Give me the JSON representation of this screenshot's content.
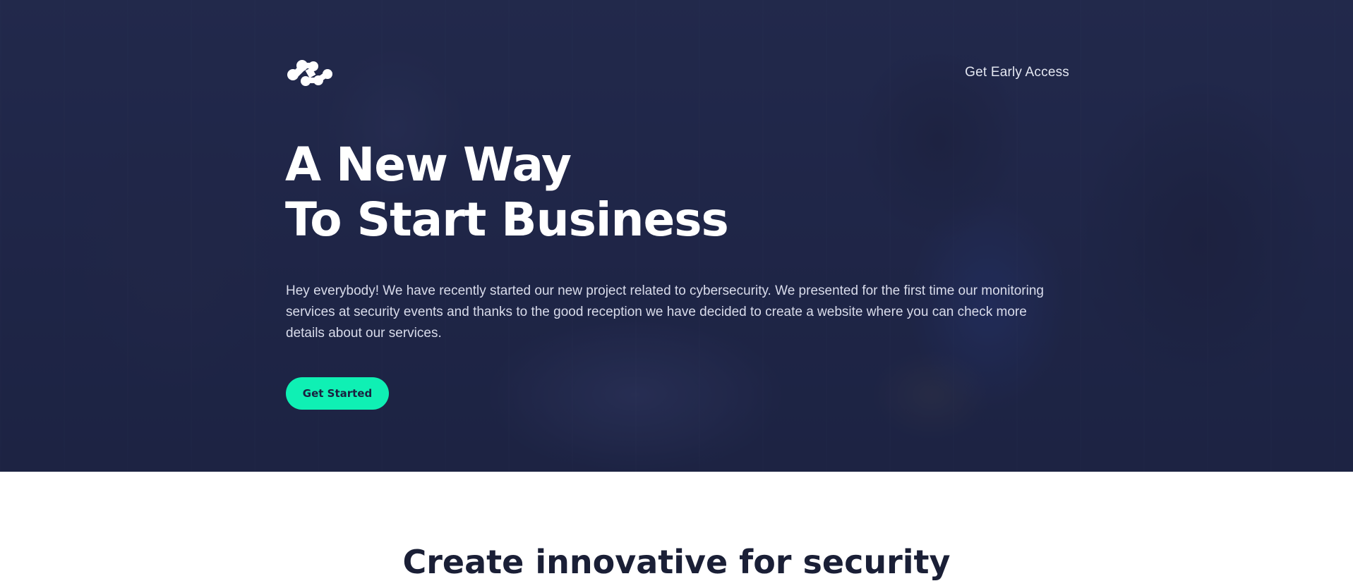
{
  "header": {
    "logo_icon": "molecule-logo-icon",
    "nav_link": "Get Early Access"
  },
  "hero": {
    "headline_line1": "A New Way",
    "headline_line2": "To Start Business",
    "description": "Hey everybody! We have recently started our new project related to cybersecurity. We presented for the first time our monitoring services at security events and thanks to the good reception we have decided to create a website where you can check more details about our services.",
    "cta_label": "Get Started"
  },
  "next_section": {
    "title": "Create innovative for security"
  },
  "colors": {
    "accent": "#0ff0b4",
    "hero_overlay": "#1b2142",
    "page_bg": "#ffffff"
  }
}
